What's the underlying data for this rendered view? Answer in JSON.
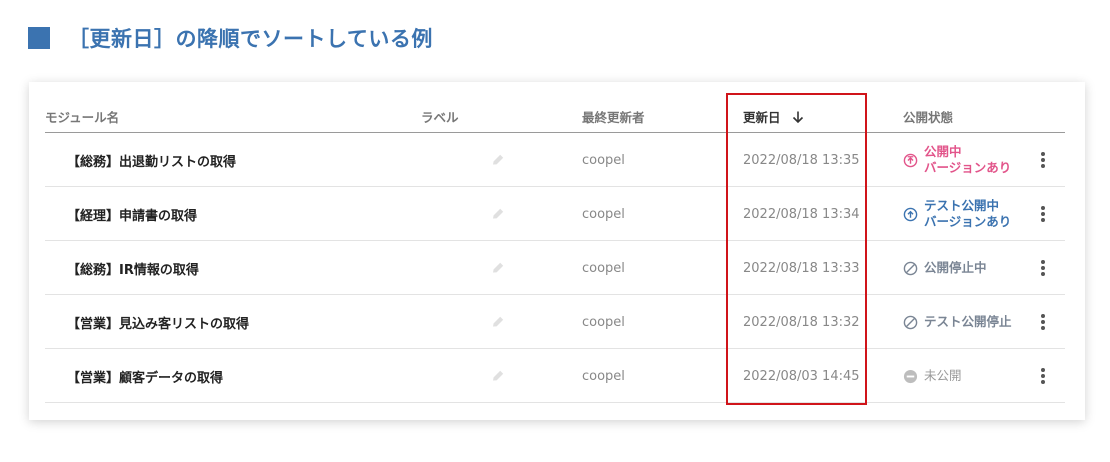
{
  "heading": {
    "text": "［更新日］の降順でソートしている例"
  },
  "table": {
    "columns": {
      "name": "モジュール名",
      "label": "ラベル",
      "user": "最終更新者",
      "date": "更新日",
      "status": "公開状態"
    },
    "sort": {
      "column": "date",
      "direction": "descending"
    },
    "rows": [
      {
        "name": "【総務】出退勤リストの取得",
        "user": "coopel",
        "date": "2022/08/18 13:35",
        "status_type": "published-version",
        "status_line1": "公開中",
        "status_line2": "バージョンあり"
      },
      {
        "name": "【経理】申請書の取得",
        "user": "coopel",
        "date": "2022/08/18 13:34",
        "status_type": "test-published-version",
        "status_line1": "テスト公開中",
        "status_line2": "バージョンあり"
      },
      {
        "name": "【総務】IR情報の取得",
        "user": "coopel",
        "date": "2022/08/18 13:33",
        "status_type": "publish-stopped",
        "status_line1": "公開停止中",
        "status_line2": ""
      },
      {
        "name": "【営業】見込み客リストの取得",
        "user": "coopel",
        "date": "2022/08/18 13:32",
        "status_type": "test-publish-stopped",
        "status_line1": "テスト公開停止",
        "status_line2": ""
      },
      {
        "name": "【営業】顧客データの取得",
        "user": "coopel",
        "date": "2022/08/03 14:45",
        "status_type": "unpublished",
        "status_line1": "未公開",
        "status_line2": ""
      }
    ]
  },
  "colors": {
    "accent": "#3b73b0",
    "published": "#e2548a",
    "test": "#3b73b0",
    "stopped": "#7a8594",
    "highlight": "#d0141a"
  }
}
